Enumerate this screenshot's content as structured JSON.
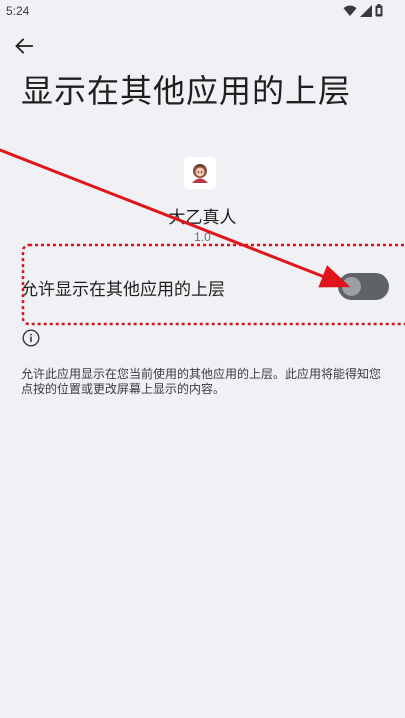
{
  "status_bar": {
    "time": "5:24",
    "icons": [
      "wifi-icon",
      "signal-icon",
      "battery-icon"
    ]
  },
  "header": {
    "back_icon": "arrow-back-icon",
    "title": "显示在其他应用的上层"
  },
  "app": {
    "name": "大乙真人",
    "version": "1.0"
  },
  "setting": {
    "label": "允许显示在其他应用的上层",
    "enabled": false
  },
  "description": "允许此应用显示在您当前使用的其他应用的上层。此应用将能得知您点按的位置或更改屏幕上显示的内容。",
  "annotation": {
    "arrow_color": "#E0151B",
    "box_color": "#D4151B"
  },
  "colors": {
    "background": "#F0F1F4",
    "switch_track_off": "#5F6368",
    "switch_thumb_off": "#9AA0A6"
  }
}
